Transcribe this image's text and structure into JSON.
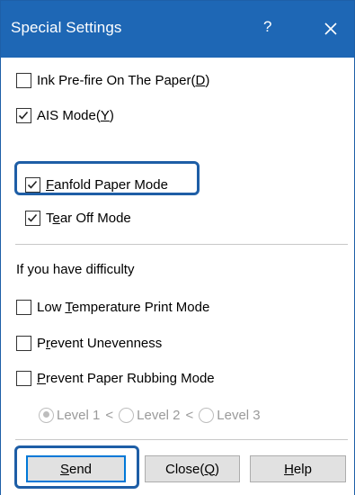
{
  "window": {
    "title": "Special Settings",
    "help_label": "?",
    "close_icon": "close-icon"
  },
  "options_top": [
    {
      "text": "Ink Pre-fire On The Paper(",
      "mnemonic": "D",
      "suffix": ")",
      "checked": false
    },
    {
      "text": "AIS Mode(",
      "mnemonic": "Y",
      "suffix": ")",
      "checked": true
    }
  ],
  "options_middle": [
    {
      "prefix": "",
      "mnemonic": "F",
      "text": "anfold Paper Mode",
      "checked": true,
      "focused": true
    },
    {
      "prefix": "T",
      "mnemonic": "e",
      "text": "ar Off Mode",
      "checked": true,
      "focused": false
    }
  ],
  "difficulty": {
    "heading": "If you have difficulty",
    "options": [
      {
        "prefix": "Low ",
        "mnemonic": "T",
        "text": "emperature Print Mode",
        "checked": false
      },
      {
        "prefix": "P",
        "mnemonic": "r",
        "text": "event Unevenness",
        "checked": false
      },
      {
        "prefix": "",
        "mnemonic": "P",
        "text": "revent Paper Rubbing Mode",
        "checked": false
      }
    ],
    "levels": [
      {
        "label": "Level 1",
        "selected": true
      },
      {
        "label": "Level 2",
        "selected": false
      },
      {
        "label": "Level 3",
        "selected": false
      }
    ],
    "separator": "<"
  },
  "buttons": {
    "send": {
      "mnemonic": "S",
      "text": "end"
    },
    "close": {
      "text": "Close(",
      "mnemonic": "Q",
      "suffix": ")"
    },
    "help": {
      "mnemonic": "H",
      "text": "elp"
    }
  },
  "colors": {
    "titlebar": "#1e67b5",
    "focus": "#1e5ea6",
    "default_button_border": "#0078d7",
    "disabled_text": "#9a9a9a"
  }
}
